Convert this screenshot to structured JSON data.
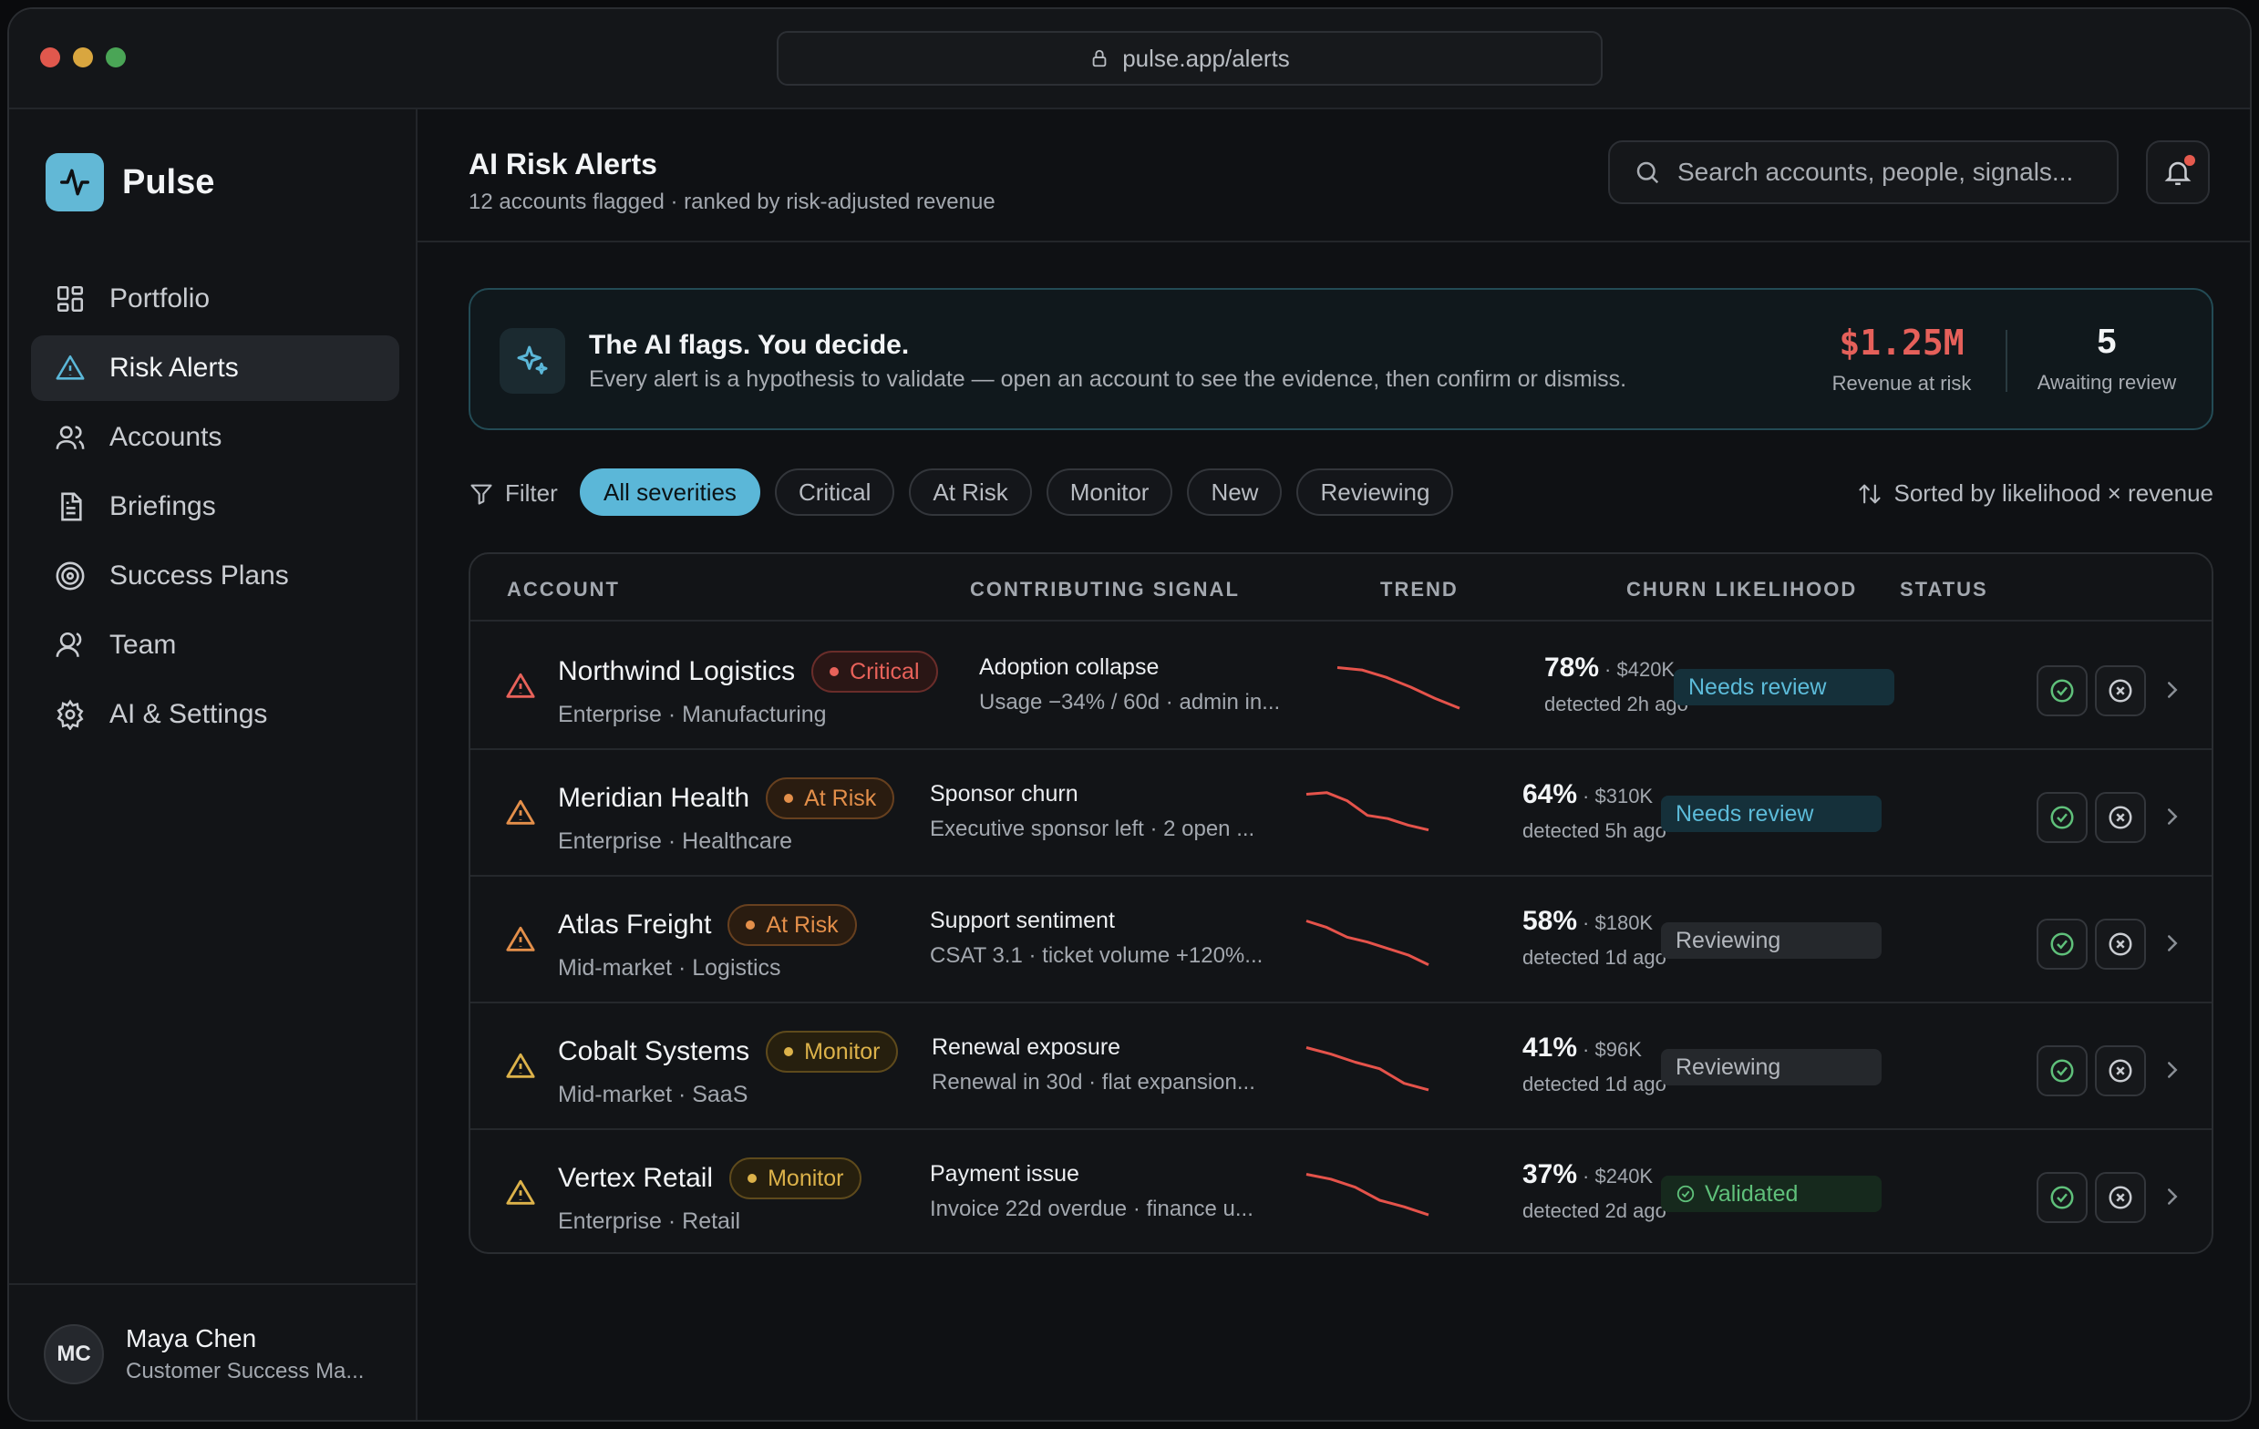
{
  "browser": {
    "url": "pulse.app/alerts"
  },
  "brand": {
    "name": "Pulse",
    "accent": "#62b8d6"
  },
  "sidebar": {
    "items": [
      {
        "label": "Portfolio",
        "icon": "grid-icon",
        "active": false
      },
      {
        "label": "Risk Alerts",
        "icon": "alert-triangle-icon",
        "active": true
      },
      {
        "label": "Accounts",
        "icon": "users-icon",
        "active": false
      },
      {
        "label": "Briefings",
        "icon": "document-icon",
        "active": false
      },
      {
        "label": "Success Plans",
        "icon": "target-icon",
        "active": false
      },
      {
        "label": "Team",
        "icon": "team-icon",
        "active": false
      },
      {
        "label": "AI & Settings",
        "icon": "gear-icon",
        "active": false
      }
    ],
    "profile": {
      "initials": "MC",
      "name": "Maya Chen",
      "role": "Customer Success Ma..."
    }
  },
  "header": {
    "title": "AI Risk Alerts",
    "subtitle": "12 accounts flagged · ranked by risk-adjusted revenue",
    "search_placeholder": "Search accounts, people, signals..."
  },
  "banner": {
    "title": "The AI flags. You decide.",
    "text": "Every alert is a hypothesis to validate — open an account to see the evidence, then confirm or dismiss.",
    "revenue_value": "$1.25M",
    "revenue_label": "Revenue at risk",
    "awaiting_value": "5",
    "awaiting_label": "Awaiting review"
  },
  "filters": {
    "label": "Filter",
    "chips": [
      "All severities",
      "Critical",
      "At Risk",
      "Monitor",
      "New",
      "Reviewing"
    ],
    "active": "All severities",
    "sort_label": "Sorted by likelihood × revenue"
  },
  "table": {
    "headers": {
      "account": "ACCOUNT",
      "signal": "CONTRIBUTING SIGNAL",
      "trend": "TREND",
      "churn": "CHURN LIKELIHOOD",
      "status": "STATUS"
    },
    "rows": [
      {
        "name": "Northwind Logistics",
        "severity": "Critical",
        "meta": "Enterprise · Manufacturing",
        "signal_title": "Adoption collapse",
        "signal_desc": "Usage −34% / 60d · admin in...",
        "pct": "78%",
        "amount": "· $420K",
        "detected": "detected 2h ago",
        "status": "Needs review",
        "trend": [
          100,
          97,
          88,
          76,
          62,
          50
        ]
      },
      {
        "name": "Meridian Health",
        "severity": "At Risk",
        "meta": "Enterprise · Healthcare",
        "signal_title": "Sponsor churn",
        "signal_desc": "Executive sponsor left · 2 open ...",
        "pct": "64%",
        "amount": "· $310K",
        "detected": "detected 5h ago",
        "status": "Needs review",
        "trend": [
          100,
          102,
          92,
          74,
          70,
          62,
          56
        ]
      },
      {
        "name": "Atlas Freight",
        "severity": "At Risk",
        "meta": "Mid-market · Logistics",
        "signal_title": "Support sentiment",
        "signal_desc": "CSAT 3.1 · ticket volume +120%...",
        "pct": "58%",
        "amount": "· $180K",
        "detected": "detected 1d ago",
        "status": "Reviewing",
        "trend": [
          100,
          92,
          80,
          74,
          66,
          58,
          46
        ]
      },
      {
        "name": "Cobalt Systems",
        "severity": "Monitor",
        "meta": "Mid-market · SaaS",
        "signal_title": "Renewal exposure",
        "signal_desc": "Renewal in 30d · flat expansion...",
        "pct": "41%",
        "amount": "· $96K",
        "detected": "detected 1d ago",
        "status": "Reviewing",
        "trend": [
          100,
          92,
          82,
          74,
          56,
          48
        ]
      },
      {
        "name": "Vertex Retail",
        "severity": "Monitor",
        "meta": "Enterprise · Retail",
        "signal_title": "Payment issue",
        "signal_desc": "Invoice 22d overdue · finance u...",
        "pct": "37%",
        "amount": "· $240K",
        "detected": "detected 2d ago",
        "status": "Validated",
        "trend": [
          100,
          94,
          84,
          68,
          60,
          50
        ]
      }
    ]
  },
  "colors": {
    "critical": "#e8625a",
    "at_risk": "#e38f4a",
    "monitor": "#dcb24a",
    "trend_line": "#e5534b",
    "validated": "#5fc07a"
  }
}
